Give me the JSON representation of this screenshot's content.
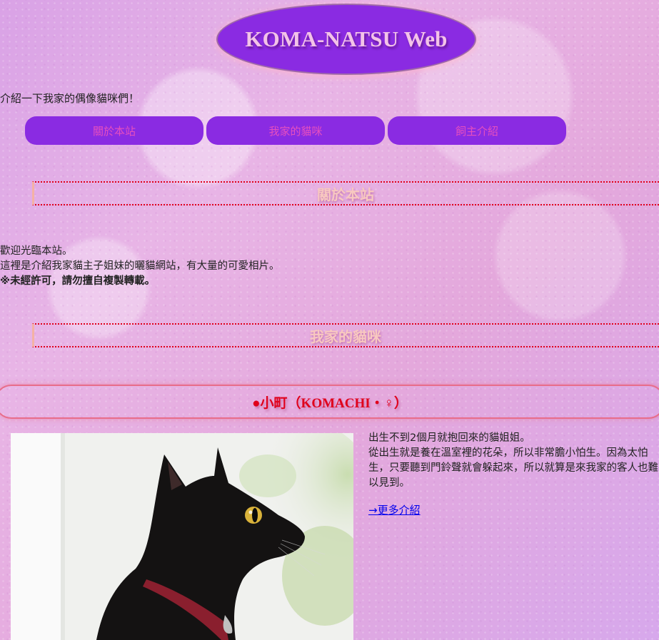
{
  "site": {
    "logo_text": "KOMA-NATSU Web",
    "intro": "介紹一下我家的偶像貓咪們！"
  },
  "nav": {
    "items": [
      {
        "label": "關於本站"
      },
      {
        "label": "我家的貓咪"
      },
      {
        "label": "飼主介紹"
      }
    ]
  },
  "about": {
    "heading": "關於本站",
    "line1": "歡迎光臨本站。",
    "line2": "這裡是介紹我家貓主子姐妹的曬貓網站，有大量的可愛相片。",
    "line3": "※未經許可，請勿擅自複製轉載。"
  },
  "cats": {
    "heading": "我家的貓咪",
    "items": [
      {
        "title": "●小町（KOMACHI・♀）",
        "desc_line1": "出生不到2個月就抱回來的貓姐姐。",
        "desc_line2": "從出生就是養在溫室裡的花朵，所以非常膽小怕生。因為太怕",
        "desc_line3": "生，只要聽到門鈴聲就會躲起來，所以就算是來我家的客人也難",
        "desc_line4": "以見到。",
        "more_link": "→更多介紹",
        "photo_alt": "black cat"
      }
    ]
  },
  "colors": {
    "logo_bg": "#8a2be2",
    "nav_bg": "#8a2be2",
    "nav_text": "#e64fbf",
    "heading_text": "#f8c8c0",
    "dotted_border": "#e0001b",
    "cat_title": "#e0001b",
    "link": "#0000ee"
  }
}
